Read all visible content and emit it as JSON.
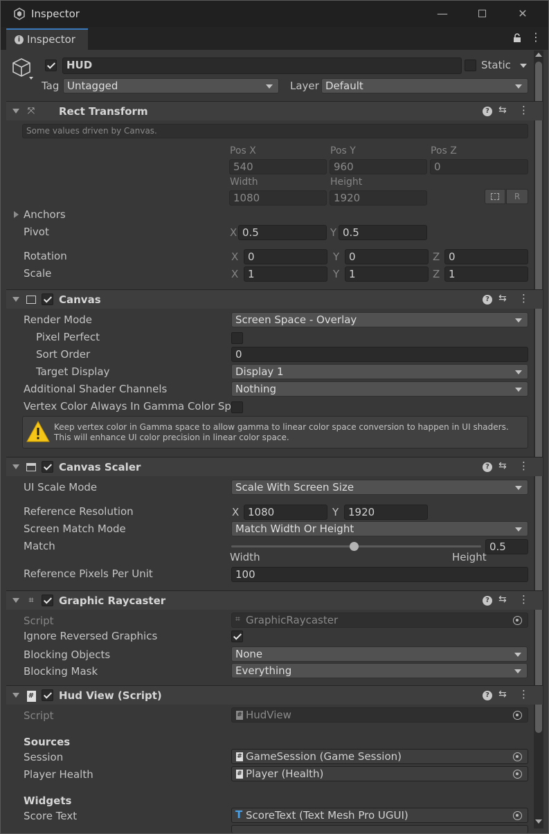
{
  "window": {
    "title": "Inspector",
    "tab": "Inspector"
  },
  "gameobject": {
    "name": "HUD",
    "static_label": "Static",
    "tag_label": "Tag",
    "tag": "Untagged",
    "layer_label": "Layer",
    "layer": "Default"
  },
  "rect": {
    "title": "Rect Transform",
    "note": "Some values driven by Canvas.",
    "posx_label": "Pos X",
    "posy_label": "Pos Y",
    "posz_label": "Pos Z",
    "posx": "540",
    "posy": "960",
    "posz": "0",
    "width_label": "Width",
    "height_label": "Height",
    "width": "1080",
    "height": "1920",
    "anchors": "Anchors",
    "pivot": "Pivot",
    "pivot_x": "0.5",
    "pivot_y": "0.5",
    "rotation": "Rotation",
    "rot_x": "0",
    "rot_y": "0",
    "rot_z": "0",
    "scale": "Scale",
    "scale_x": "1",
    "scale_y": "1",
    "scale_z": "1",
    "r_btn": "R"
  },
  "axes": {
    "x": "X",
    "y": "Y",
    "z": "Z"
  },
  "canvas": {
    "title": "Canvas",
    "render_mode_label": "Render Mode",
    "render_mode": "Screen Space - Overlay",
    "pixel_perfect": "Pixel Perfect",
    "sort_order_label": "Sort Order",
    "sort_order": "0",
    "target_display_label": "Target Display",
    "target_display": "Display 1",
    "shader_channels_label": "Additional Shader Channels",
    "shader_channels": "Nothing",
    "vertex_color_label": "Vertex Color Always In Gamma Color Spac",
    "warning": "Keep vertex color in Gamma space to allow gamma to linear color space conversion to happen in UI shaders. This will enhance UI color precision in linear color space."
  },
  "scaler": {
    "title": "Canvas Scaler",
    "mode_label": "UI Scale Mode",
    "mode": "Scale With Screen Size",
    "ref_res_label": "Reference Resolution",
    "ref_x": "1080",
    "ref_y": "1920",
    "match_mode_label": "Screen Match Mode",
    "match_mode": "Match Width Or Height",
    "match_label": "Match",
    "match_value": "0.5",
    "match_fraction": 0.5,
    "width_label": "Width",
    "height_label": "Height",
    "ppu_label": "Reference Pixels Per Unit",
    "ppu": "100"
  },
  "raycaster": {
    "title": "Graphic Raycaster",
    "script_label": "Script",
    "script": "GraphicRaycaster",
    "ignore_label": "Ignore Reversed Graphics",
    "blocking_objects_label": "Blocking Objects",
    "blocking_objects": "None",
    "blocking_mask_label": "Blocking Mask",
    "blocking_mask": "Everything"
  },
  "hudview": {
    "title": "Hud View (Script)",
    "script_label": "Script",
    "script": "HudView",
    "sources_header": "Sources",
    "session_label": "Session",
    "session": "GameSession (Game Session)",
    "health_label": "Player Health",
    "health": "Player (Health)",
    "widgets_header": "Widgets",
    "score_label": "Score Text",
    "score": "ScoreText (Text Mesh Pro UGUI)"
  },
  "icons": {
    "help": "?"
  }
}
